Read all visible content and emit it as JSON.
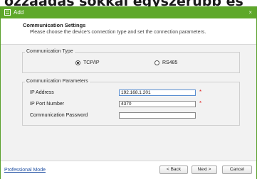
{
  "background": {
    "heading": "ozzaadás sokkal egyszerűbb és"
  },
  "window": {
    "title": "Add",
    "close_glyph": "×"
  },
  "header": {
    "title": "Communication Settings",
    "subtitle": "Please choose the device's connection type and set the connection parameters."
  },
  "communication_type": {
    "legend": "Communication Type",
    "options": [
      {
        "label": "TCP/IP",
        "selected": true
      },
      {
        "label": "RS485",
        "selected": false
      }
    ]
  },
  "communication_parameters": {
    "legend": "Communication Parameters",
    "fields": [
      {
        "label": "IP Address",
        "value": "192.168.1.201",
        "required": true,
        "required_mark": "*"
      },
      {
        "label": "IP Port Number",
        "value": "4370",
        "required": true,
        "required_mark": "*"
      },
      {
        "label": "Communication Password",
        "value": "",
        "required": false
      }
    ]
  },
  "footer": {
    "link": "Professional Mode",
    "back": "< Back",
    "next": "Next >",
    "cancel": "Cancel"
  },
  "colors": {
    "accent": "#5ea82a",
    "required": "#e02020",
    "link": "#1f4fa3"
  }
}
